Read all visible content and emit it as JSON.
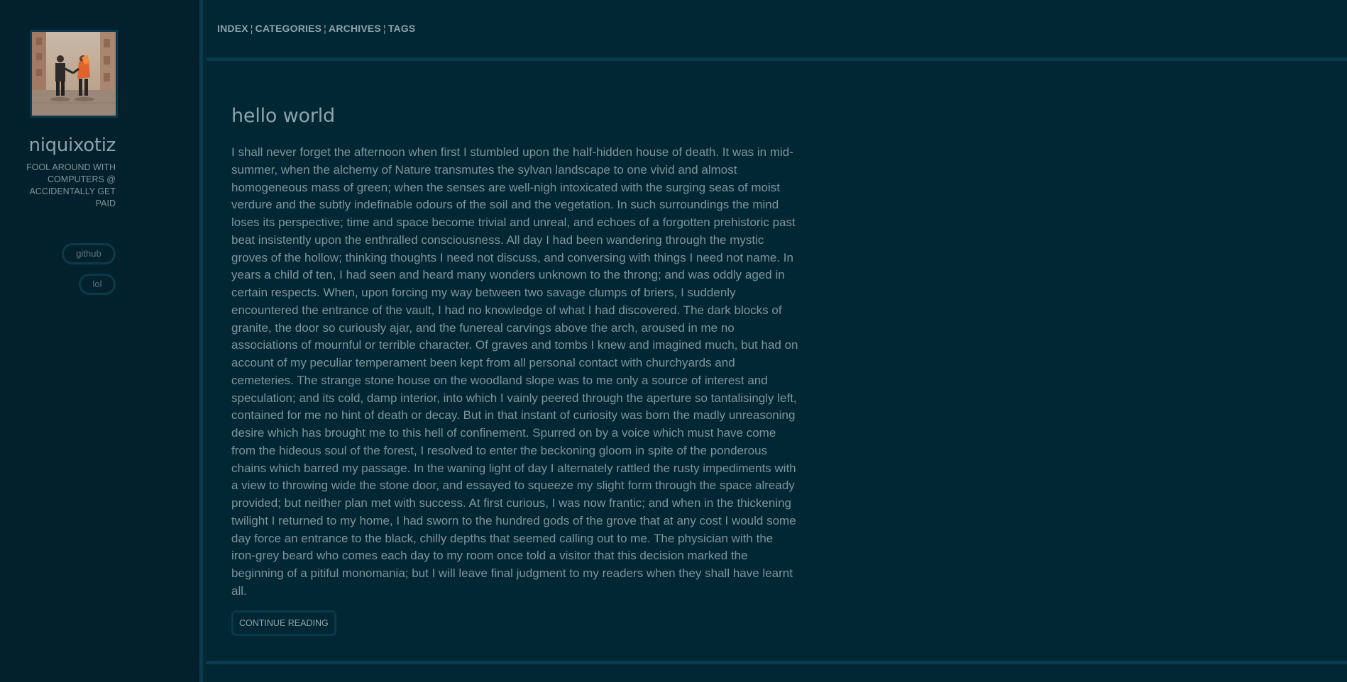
{
  "sidebar": {
    "avatar": "album-cover-avatar",
    "site_title": "niquixotiz",
    "tagline": "FOOL AROUND WITH COMPUTERS @ ACCIDENTALLY GET PAID",
    "links": [
      {
        "label": "github"
      },
      {
        "label": "lol"
      }
    ]
  },
  "nav": {
    "items": [
      "INDEX",
      "CATEGORIES",
      "ARCHIVES",
      "TAGS"
    ],
    "separator": "¦"
  },
  "post": {
    "title": "hello world",
    "body": "I shall never forget the afternoon when first I stumbled upon the half-hidden house of death. It was in mid-summer, when the alchemy of Nature transmutes the sylvan landscape to one vivid and almost homogeneous mass of green; when the senses are well-nigh intoxicated with the surging seas of moist verdure and the subtly indefinable odours of the soil and the vegetation. In such surroundings the mind loses its perspective; time and space become trivial and unreal, and echoes of a forgotten prehistoric past beat insistently upon the enthralled consciousness. All day I had been wandering through the mystic groves of the hollow; thinking thoughts I need not discuss, and conversing with things I need not name. In years a child of ten, I had seen and heard many wonders unknown to the throng; and was oddly aged in certain respects. When, upon forcing my way between two savage clumps of briers, I suddenly encountered the entrance of the vault, I had no knowledge of what I had discovered. The dark blocks of granite, the door so curiously ajar, and the funereal carvings above the arch, aroused in me no associations of mournful or terrible character. Of graves and tombs I knew and imagined much, but had on account of my peculiar temperament been kept from all personal contact with churchyards and cemeteries. The strange stone house on the woodland slope was to me only a source of interest and speculation; and its cold, damp interior, into which I vainly peered through the aperture so tantalisingly left, contained for me no hint of death or decay. But in that instant of curiosity was born the madly unreasoning desire which has brought me to this hell of confinement. Spurred on by a voice which must have come from the hideous soul of the forest, I resolved to enter the beckoning gloom in spite of the ponderous chains which barred my passage. In the waning light of day I alternately rattled the rusty impediments with a view to throwing wide the stone door, and essayed to squeeze my slight form through the space already provided; but neither plan met with success. At first curious, I was now frantic; and when in the thickening twilight I returned to my home, I had sworn to the hundred gods of the grove that at any cost I would some day force an entrance to the black, chilly depths that seemed calling out to me. The physician with the iron-grey beard who comes each day to my room once told a visitor that this decision marked the beginning of a pitiful monomania; but I will leave final judgment to my readers when they shall have learnt all.",
    "continue_label": "CONTINUE READING"
  },
  "colors": {
    "background": "#022734",
    "sidebar": "#03212c",
    "border": "#0a3a4b",
    "text": "#8ea3ab"
  }
}
